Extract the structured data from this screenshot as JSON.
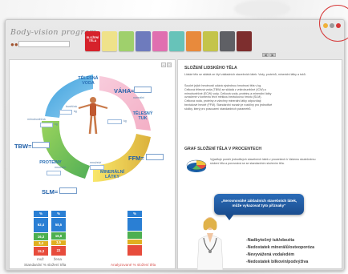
{
  "app": {
    "logo": "Body-vision program"
  },
  "tabs": [
    {
      "label": "SLOŽENÍ\nTĚLA",
      "color": "#d6222b"
    },
    {
      "label": "",
      "color": "#efe28a"
    },
    {
      "label": "",
      "color": "#9fd06c"
    },
    {
      "label": "",
      "color": "#6e7bbd"
    },
    {
      "label": "",
      "color": "#e06fb0"
    },
    {
      "label": "",
      "color": "#67c3b9"
    },
    {
      "label": "",
      "color": "#e88a3c"
    },
    {
      "label": "",
      "color": "#c4c44a"
    },
    {
      "label": "",
      "color": "#5f6065"
    },
    {
      "label": "",
      "color": "#7d2e2e"
    }
  ],
  "diagram": {
    "telesna_voda": "TĚLESNÁ\nVODA",
    "vaha": "VÁHA=",
    "telesny_tuk": "TĚLESNÝ\nTUK",
    "tbw": "TBW=",
    "proteiny": "PROTEINY",
    "ffm": "FFM=",
    "slm": "SLM=",
    "mineralni_latky": "MINERÁLNÍ\nLÁTKY",
    "kg": "kg",
    "normal": "normální",
    "bunky": "buněčná",
    "mimobunky": "mimobuněčná",
    "mnozstvi": "množství"
  },
  "bars": {
    "left_values": [
      "62,4",
      "16,3",
      "3,4",
      "15,3"
    ],
    "left_header": "%",
    "right_values": [
      "58,5",
      "16,8",
      "3,5",
      "22"
    ],
    "right_header": "%",
    "muz": "muž",
    "zena": "žena",
    "standard_caption": "Standardní % složení těla",
    "analyzed_header": "%",
    "analyzed_caption": "Analyzované % složení těla"
  },
  "right_panel": {
    "section1_title": "SLOŽENÍ LIDSKÉHO TĚLA",
    "section1_p1": "Lidské tělo se skládá ze čtyř základních stavebních látek: Vody, proteinů, minerální látky a tuků.",
    "section1_p2": "Součet jejich hmotnosti udává výslednou hmotnost těla v kg. Celková tělesná voda (TBW) se skládá z vnitrobuněčné (ICW) a mimobuněčné (ECW) vody. Celková voda, proteiny a minerální látky označené v kontextu těch měkkou beztukovou hmotu (SLM). Celková voda, proteiny a všechny minerální látky odpovídají beztukové hmotě (FFM). Standardní rozsah je rozdílný pro jednotlivé složky, který pro posouzení standardních parametrů.",
    "section2_title": "GRAF SLOŽENÍ TĚLA V PROCENTECH",
    "section2_p": "Vyjadřuje poměr jednotlivých stavebních látek v procentech k Vašemu skutečnému složení těla a porovnává se se standardním složením těla.",
    "callout": "„Nerovnováhé základních stavebních látek,\nmůže vykazovat tyto příznaky“",
    "list": [
      "-Nadbytočný tuk/obezita",
      "-Nedostatek minerálů/osteoporóza",
      "-Nevyvážená voda/edém",
      "-Nedostatek bílkovin/podvýživa"
    ]
  }
}
